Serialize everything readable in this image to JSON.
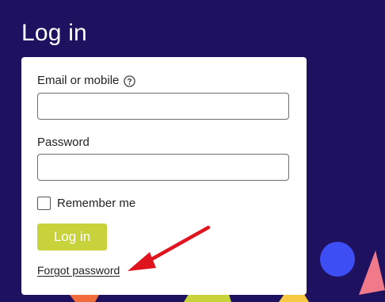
{
  "page": {
    "title": "Log in",
    "background_color": "#1e1260"
  },
  "form": {
    "email_label": "Email or mobile",
    "email_value": "",
    "email_help_icon": "question-circle-icon",
    "password_label": "Password",
    "password_value": "",
    "remember_label": "Remember me",
    "remember_checked": false,
    "submit_label": "Log in",
    "forgot_label": "Forgot password"
  },
  "colors": {
    "button": "#c8d23a",
    "annotation_arrow": "#e0141e",
    "shape_blue": "#3d4ef5",
    "shape_pink": "#f07a8a",
    "shape_lime": "#c8d23a",
    "shape_orange": "#f26b3a"
  },
  "annotation": {
    "icon": "red-arrow-icon",
    "target": "forgot-password-link"
  }
}
